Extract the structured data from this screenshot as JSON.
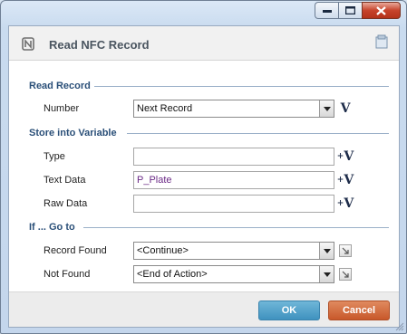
{
  "window": {
    "title": "Read NFC Record",
    "caption_buttons": [
      "minimize",
      "maximize",
      "close"
    ]
  },
  "sections": {
    "read_record": {
      "title": "Read Record",
      "number_label": "Number",
      "number_value": "Next Record"
    },
    "store": {
      "title": "Store into Variable",
      "type_label": "Type",
      "type_value": "",
      "text_label": "Text Data",
      "text_value": "P_Plate",
      "raw_label": "Raw Data",
      "raw_value": ""
    },
    "goto": {
      "title": "If ... Go to",
      "found_label": "Record Found",
      "found_value": "<Continue>",
      "notfound_label": "Not Found",
      "notfound_value": "<End of Action>"
    }
  },
  "footer": {
    "ok_label": "OK",
    "cancel_label": "Cancel"
  },
  "icons": {
    "header": "nfc-icon",
    "note": "note-icon",
    "variable": "variable-insert-icon",
    "goto": "goto-arrow-icon"
  },
  "colors": {
    "ok": "#4a9ac6",
    "cancel": "#d06a3a",
    "section_title": "#2a4f78"
  }
}
